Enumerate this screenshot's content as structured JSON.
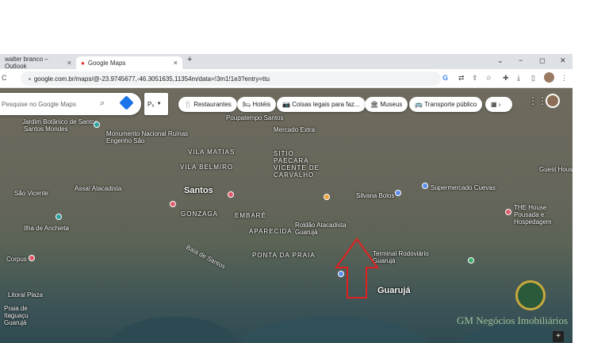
{
  "browser": {
    "tabs": [
      {
        "label": "walter branco – Outlook",
        "close": "×"
      },
      {
        "label": "Google Maps",
        "close": "×"
      }
    ],
    "new_tab": "+",
    "window_controls": [
      "⌄",
      "−",
      "◻",
      "✕"
    ],
    "url": "google.com.br/maps/@-23.9745677,-46.3051635,11354m/data=!3m1!1e3?entry=ttu"
  },
  "maps": {
    "search_placeholder": "Pesquise no Google Maps",
    "filter_label": "P₆",
    "chips": [
      "Restaurantes",
      "Hotéis",
      "Coisas legais para faz...",
      "Museus",
      "Transporte público"
    ],
    "labels": [
      "Jardim Botânico de Santos",
      "Santos Mondes",
      "Monumento Nacional Ruínas Engenho São",
      "Poupatempo Santos",
      "Mercado Extra",
      "VILA MATIAS",
      "SITIO PAECARA VICENTE DE CARVALHO",
      "VILA BELMIRO",
      "São Vicente",
      "Santos",
      "Assaí Atacadista",
      "Silvana Bolos",
      "Supermercado Cuevas",
      "GONZAGA",
      "EMBARÉ",
      "APARECIDA",
      "Roldão Atacadista Guarujá",
      "PONTA DA PRAIA",
      "Terminal Rodoviário Guarujá",
      "Corpus",
      "Litoral Plaza",
      "Guarujá",
      "THE House Pousada e Hospedagem",
      "Ilha de Anchieta",
      "Baía de Santos",
      "Guest House",
      "Praia de Itaguaçu Guarujá"
    ],
    "watermark": "GM Negócios Imobiliários"
  }
}
